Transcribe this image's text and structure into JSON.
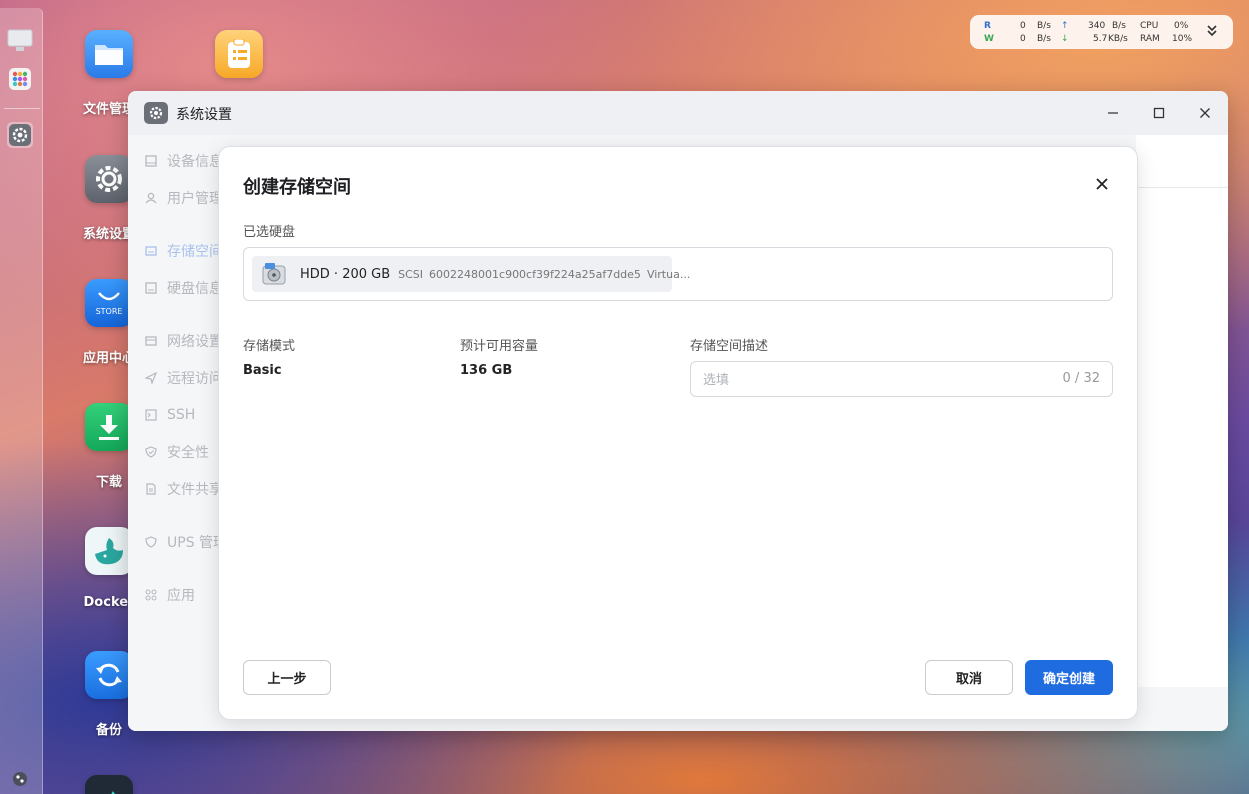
{
  "desktop": {
    "icons": [
      {
        "label": "文件管理"
      },
      {
        "label": ""
      },
      {
        "label": "系统设置"
      },
      {
        "label": "应用中心"
      },
      {
        "label": "下载"
      },
      {
        "label": "Docker"
      },
      {
        "label": "备份"
      }
    ],
    "store_text": "STORE"
  },
  "monitor": {
    "r_label": "R",
    "w_label": "W",
    "r_rate": "0",
    "r_unit": "B/s",
    "w_rate": "0",
    "w_unit": "B/s",
    "up_rate": "340",
    "up_unit": "B/s",
    "down_rate": "5.7",
    "down_unit": "KB/s",
    "cpu_label": "CPU",
    "cpu_value": "0%",
    "ram_label": "RAM",
    "ram_value": "10%",
    "colors": {
      "r": "#2f6fd6",
      "w": "#3aa757"
    }
  },
  "window": {
    "title": "系统设置",
    "sidebar": [
      {
        "label": "设备信息"
      },
      {
        "label": "用户管理"
      },
      {
        "label": "存储空间"
      },
      {
        "label": "硬盘信息"
      },
      {
        "label": "网络设置"
      },
      {
        "label": "远程访问"
      },
      {
        "label": "SSH"
      },
      {
        "label": "安全性"
      },
      {
        "label": "文件共享"
      },
      {
        "label": "UPS 管理"
      },
      {
        "label": "应用"
      }
    ]
  },
  "dialog": {
    "title": "创建存储空间",
    "selected_disks_label": "已选硬盘",
    "disk": {
      "name": "HDD · 200 GB",
      "bus": "SCSI",
      "serial": "6002248001c900cf39f224a25af7dde5",
      "model": "Virtua..."
    },
    "mode_label": "存储模式",
    "mode_value": "Basic",
    "capacity_label": "预计可用容量",
    "capacity_value": "136 GB",
    "desc_label": "存储空间描述",
    "desc_placeholder": "选填",
    "desc_value": "",
    "desc_count": "0 / 32",
    "prev_button": "上一步",
    "cancel_button": "取消",
    "confirm_button": "确定创建"
  },
  "colors": {
    "primary": "#1f6be0"
  }
}
